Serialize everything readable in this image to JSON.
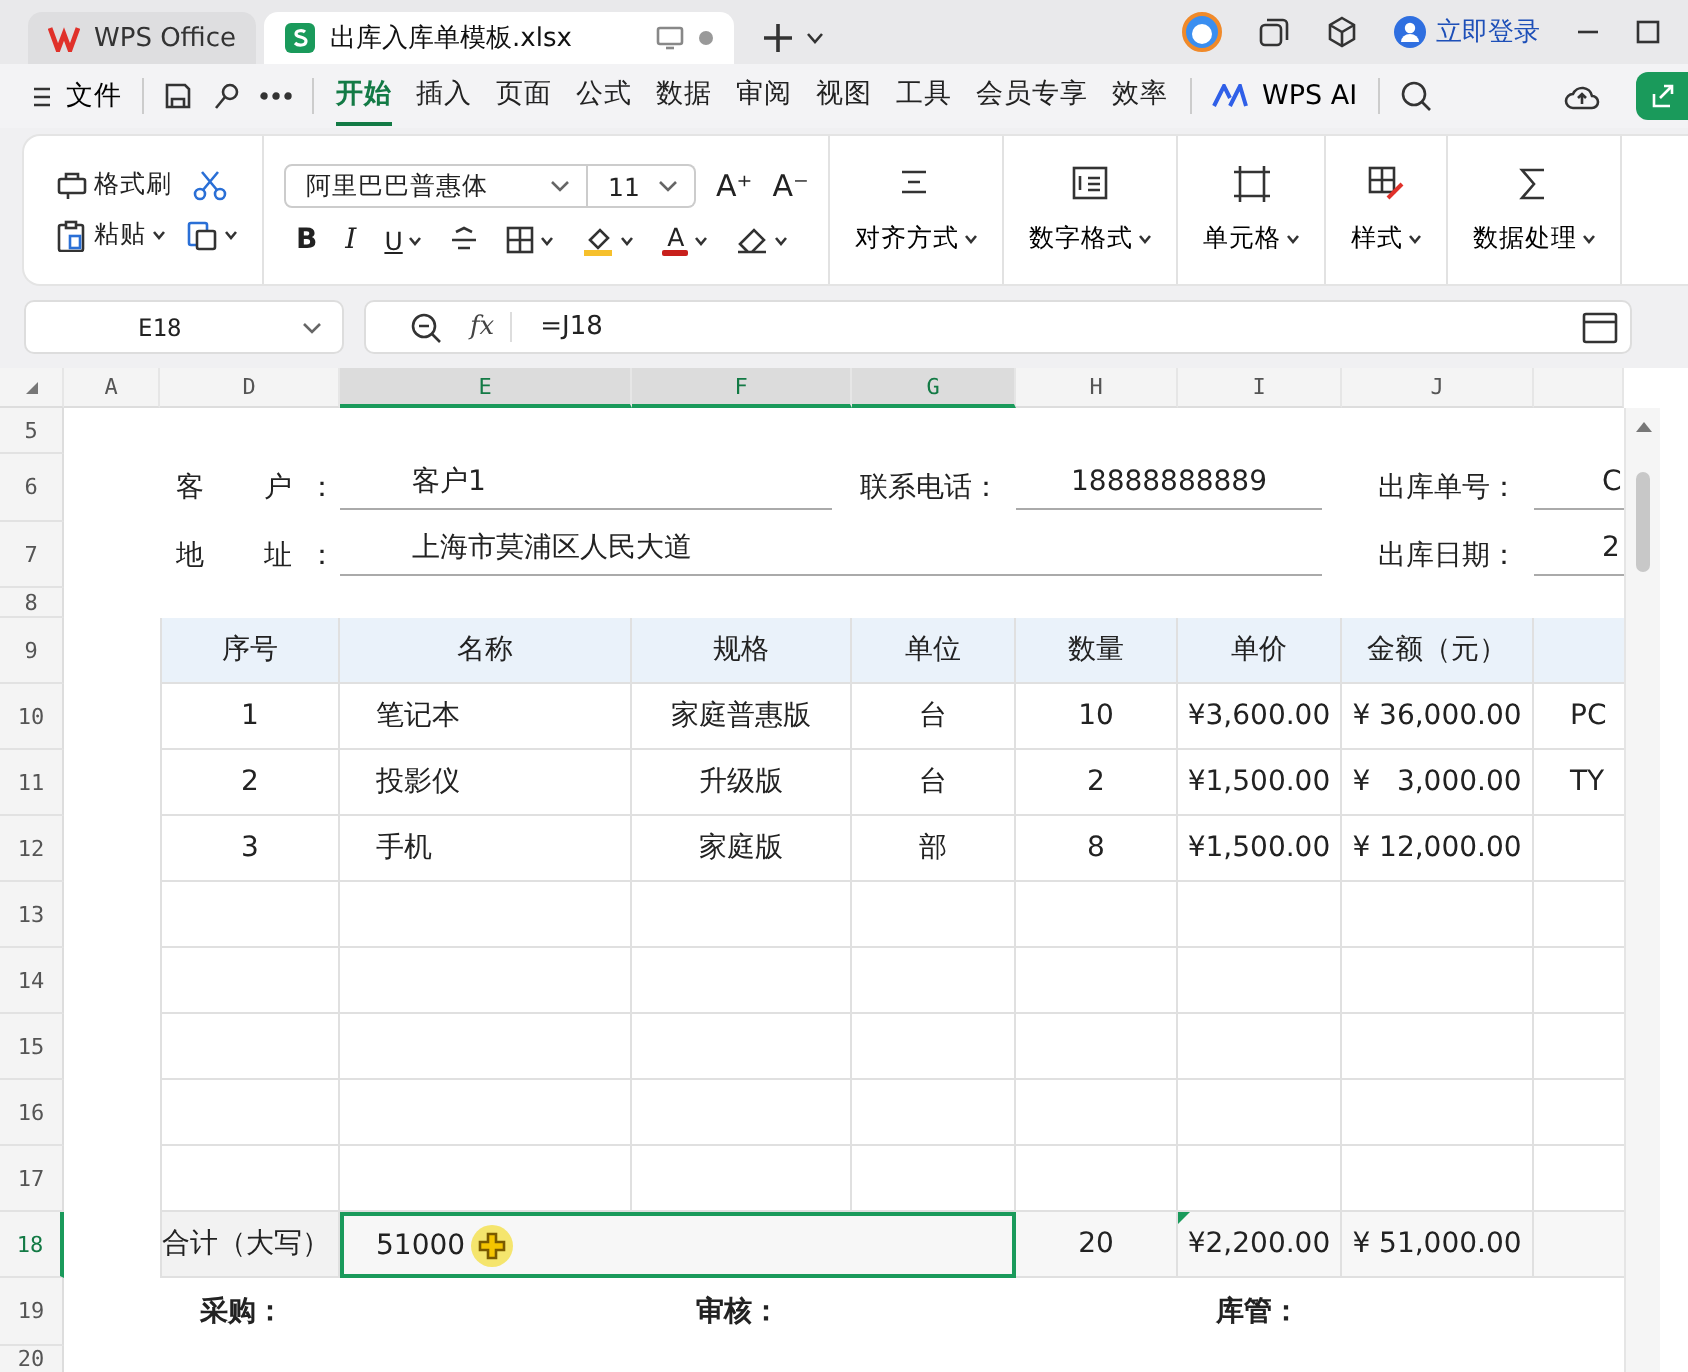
{
  "tabs": [
    {
      "label": "WPS Office",
      "selected": false
    },
    {
      "label": "出库入库单模板.xlsx",
      "selected": true
    }
  ],
  "account": {
    "label": "立即登录"
  },
  "menu": {
    "file": "文件",
    "tabs": [
      {
        "label": "开始",
        "selected": true
      },
      {
        "label": "插入",
        "selected": false
      },
      {
        "label": "页面",
        "selected": false
      },
      {
        "label": "公式",
        "selected": false
      },
      {
        "label": "数据",
        "selected": false
      },
      {
        "label": "审阅",
        "selected": false
      },
      {
        "label": "视图",
        "selected": false
      },
      {
        "label": "工具",
        "selected": false
      },
      {
        "label": "会员专享",
        "selected": false
      },
      {
        "label": "效率",
        "selected": false
      }
    ],
    "ai": "WPS AI"
  },
  "ribbon": {
    "format_painter": "格式刷",
    "paste": "粘贴",
    "font": "阿里巴巴普惠体",
    "size": "11",
    "grow": "A⁺",
    "shrink": "A⁻",
    "bold": "B",
    "italic": "I",
    "underline": "U",
    "font_color": "A",
    "big_buttons": [
      "对齐方式",
      "数字格式",
      "单元格",
      "样式",
      "数据处理"
    ]
  },
  "formula_bar": {
    "cell": "E18",
    "fx": "fx",
    "formula": "=J18"
  },
  "sheet": {
    "columns": [
      {
        "label": "A",
        "selected": false
      },
      {
        "label": "D",
        "selected": false
      },
      {
        "label": "E",
        "selected": true
      },
      {
        "label": "F",
        "selected": true
      },
      {
        "label": "G",
        "selected": true
      },
      {
        "label": "H",
        "selected": false
      },
      {
        "label": "I",
        "selected": false
      },
      {
        "label": "J",
        "selected": false
      }
    ],
    "rows": [
      {
        "label": "5",
        "selected": false
      },
      {
        "label": "6",
        "selected": false
      },
      {
        "label": "7",
        "selected": false
      },
      {
        "label": "8",
        "selected": false
      },
      {
        "label": "9",
        "selected": false
      },
      {
        "label": "10",
        "selected": false
      },
      {
        "label": "11",
        "selected": false
      },
      {
        "label": "12",
        "selected": false
      },
      {
        "label": "13",
        "selected": false
      },
      {
        "label": "14",
        "selected": false
      },
      {
        "label": "15",
        "selected": false
      },
      {
        "label": "16",
        "selected": false
      },
      {
        "label": "17",
        "selected": false
      },
      {
        "label": "18",
        "selected": true
      },
      {
        "label": "19",
        "selected": false
      },
      {
        "label": "20",
        "selected": false
      }
    ]
  },
  "form": {
    "customer_label": "客　户：",
    "customer": "客户1",
    "phone_label": "联系电话：",
    "phone": "18888888889",
    "order_no_label": "出库单号：",
    "order_no": "C",
    "address_label": "地　址：",
    "address": "上海市莫浦区人民大道",
    "date_label": "出库日期：",
    "date": "2"
  },
  "table": {
    "columns": [
      "序号",
      "名称",
      "规格",
      "单位",
      "数量",
      "单价",
      "金额（元）"
    ],
    "rows": [
      [
        "1",
        "笔记本",
        "家庭普惠版",
        "台",
        "10",
        "¥3,600.00",
        "¥ 36,000.00",
        "PC"
      ],
      [
        "2",
        "投影仪",
        "升级版",
        "台",
        "2",
        "¥1,500.00",
        "¥   3,000.00",
        "TY"
      ],
      [
        "3",
        "手机",
        "家庭版",
        "部",
        "8",
        "¥1,500.00",
        "¥ 12,000.00",
        ""
      ]
    ]
  },
  "totals": {
    "label": "合计（大写）",
    "in_words": "51000",
    "quantity": "20",
    "unit_price": "¥2,200.00",
    "amount": "¥ 51,000.00"
  },
  "signatures": [
    "采购：",
    "审核：",
    "库管："
  ]
}
